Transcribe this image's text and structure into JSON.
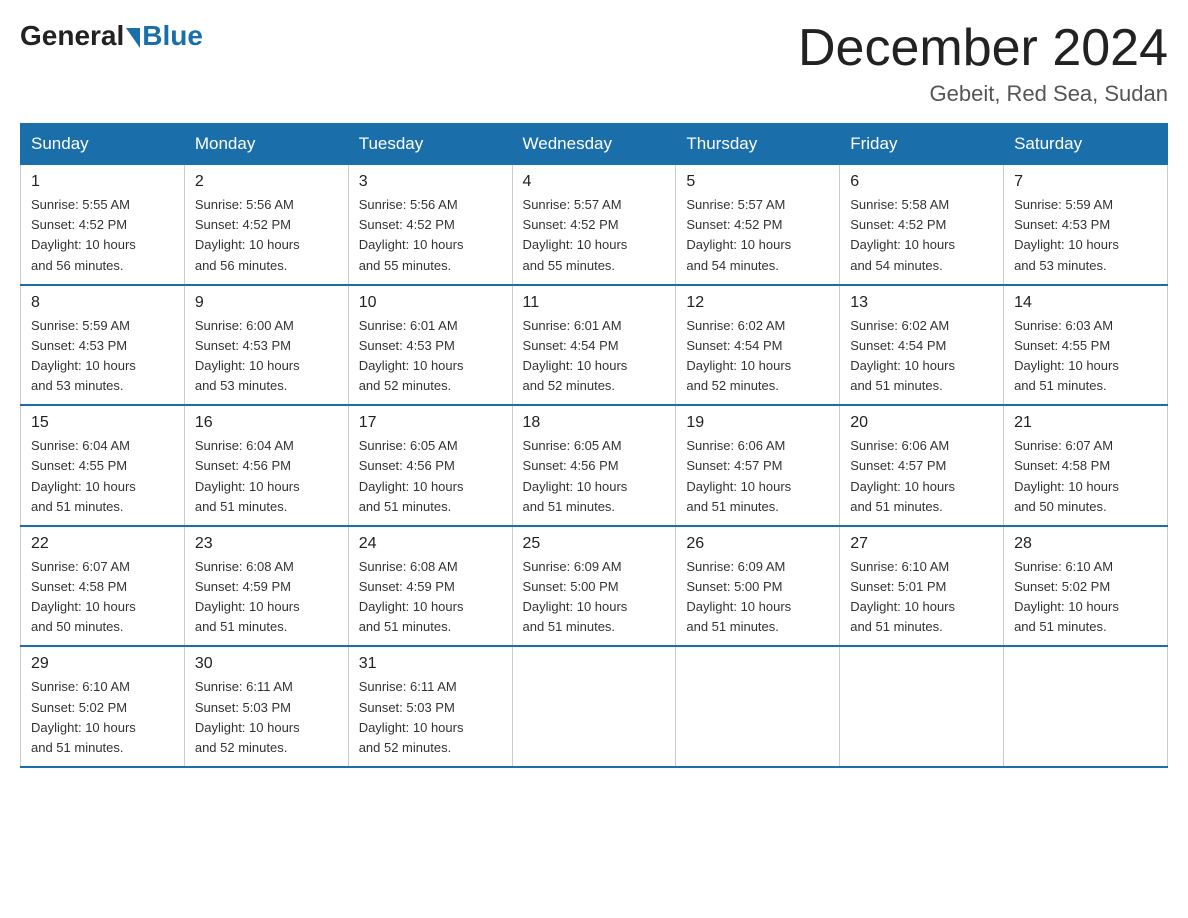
{
  "header": {
    "logo_general": "General",
    "logo_blue": "Blue",
    "month_year": "December 2024",
    "location": "Gebeit, Red Sea, Sudan"
  },
  "days_of_week": [
    "Sunday",
    "Monday",
    "Tuesday",
    "Wednesday",
    "Thursday",
    "Friday",
    "Saturday"
  ],
  "weeks": [
    [
      {
        "day": "1",
        "sunrise": "5:55 AM",
        "sunset": "4:52 PM",
        "daylight": "10 hours and 56 minutes."
      },
      {
        "day": "2",
        "sunrise": "5:56 AM",
        "sunset": "4:52 PM",
        "daylight": "10 hours and 56 minutes."
      },
      {
        "day": "3",
        "sunrise": "5:56 AM",
        "sunset": "4:52 PM",
        "daylight": "10 hours and 55 minutes."
      },
      {
        "day": "4",
        "sunrise": "5:57 AM",
        "sunset": "4:52 PM",
        "daylight": "10 hours and 55 minutes."
      },
      {
        "day": "5",
        "sunrise": "5:57 AM",
        "sunset": "4:52 PM",
        "daylight": "10 hours and 54 minutes."
      },
      {
        "day": "6",
        "sunrise": "5:58 AM",
        "sunset": "4:52 PM",
        "daylight": "10 hours and 54 minutes."
      },
      {
        "day": "7",
        "sunrise": "5:59 AM",
        "sunset": "4:53 PM",
        "daylight": "10 hours and 53 minutes."
      }
    ],
    [
      {
        "day": "8",
        "sunrise": "5:59 AM",
        "sunset": "4:53 PM",
        "daylight": "10 hours and 53 minutes."
      },
      {
        "day": "9",
        "sunrise": "6:00 AM",
        "sunset": "4:53 PM",
        "daylight": "10 hours and 53 minutes."
      },
      {
        "day": "10",
        "sunrise": "6:01 AM",
        "sunset": "4:53 PM",
        "daylight": "10 hours and 52 minutes."
      },
      {
        "day": "11",
        "sunrise": "6:01 AM",
        "sunset": "4:54 PM",
        "daylight": "10 hours and 52 minutes."
      },
      {
        "day": "12",
        "sunrise": "6:02 AM",
        "sunset": "4:54 PM",
        "daylight": "10 hours and 52 minutes."
      },
      {
        "day": "13",
        "sunrise": "6:02 AM",
        "sunset": "4:54 PM",
        "daylight": "10 hours and 51 minutes."
      },
      {
        "day": "14",
        "sunrise": "6:03 AM",
        "sunset": "4:55 PM",
        "daylight": "10 hours and 51 minutes."
      }
    ],
    [
      {
        "day": "15",
        "sunrise": "6:04 AM",
        "sunset": "4:55 PM",
        "daylight": "10 hours and 51 minutes."
      },
      {
        "day": "16",
        "sunrise": "6:04 AM",
        "sunset": "4:56 PM",
        "daylight": "10 hours and 51 minutes."
      },
      {
        "day": "17",
        "sunrise": "6:05 AM",
        "sunset": "4:56 PM",
        "daylight": "10 hours and 51 minutes."
      },
      {
        "day": "18",
        "sunrise": "6:05 AM",
        "sunset": "4:56 PM",
        "daylight": "10 hours and 51 minutes."
      },
      {
        "day": "19",
        "sunrise": "6:06 AM",
        "sunset": "4:57 PM",
        "daylight": "10 hours and 51 minutes."
      },
      {
        "day": "20",
        "sunrise": "6:06 AM",
        "sunset": "4:57 PM",
        "daylight": "10 hours and 51 minutes."
      },
      {
        "day": "21",
        "sunrise": "6:07 AM",
        "sunset": "4:58 PM",
        "daylight": "10 hours and 50 minutes."
      }
    ],
    [
      {
        "day": "22",
        "sunrise": "6:07 AM",
        "sunset": "4:58 PM",
        "daylight": "10 hours and 50 minutes."
      },
      {
        "day": "23",
        "sunrise": "6:08 AM",
        "sunset": "4:59 PM",
        "daylight": "10 hours and 51 minutes."
      },
      {
        "day": "24",
        "sunrise": "6:08 AM",
        "sunset": "4:59 PM",
        "daylight": "10 hours and 51 minutes."
      },
      {
        "day": "25",
        "sunrise": "6:09 AM",
        "sunset": "5:00 PM",
        "daylight": "10 hours and 51 minutes."
      },
      {
        "day": "26",
        "sunrise": "6:09 AM",
        "sunset": "5:00 PM",
        "daylight": "10 hours and 51 minutes."
      },
      {
        "day": "27",
        "sunrise": "6:10 AM",
        "sunset": "5:01 PM",
        "daylight": "10 hours and 51 minutes."
      },
      {
        "day": "28",
        "sunrise": "6:10 AM",
        "sunset": "5:02 PM",
        "daylight": "10 hours and 51 minutes."
      }
    ],
    [
      {
        "day": "29",
        "sunrise": "6:10 AM",
        "sunset": "5:02 PM",
        "daylight": "10 hours and 51 minutes."
      },
      {
        "day": "30",
        "sunrise": "6:11 AM",
        "sunset": "5:03 PM",
        "daylight": "10 hours and 52 minutes."
      },
      {
        "day": "31",
        "sunrise": "6:11 AM",
        "sunset": "5:03 PM",
        "daylight": "10 hours and 52 minutes."
      },
      null,
      null,
      null,
      null
    ]
  ],
  "labels": {
    "sunrise": "Sunrise:",
    "sunset": "Sunset:",
    "daylight": "Daylight:"
  }
}
